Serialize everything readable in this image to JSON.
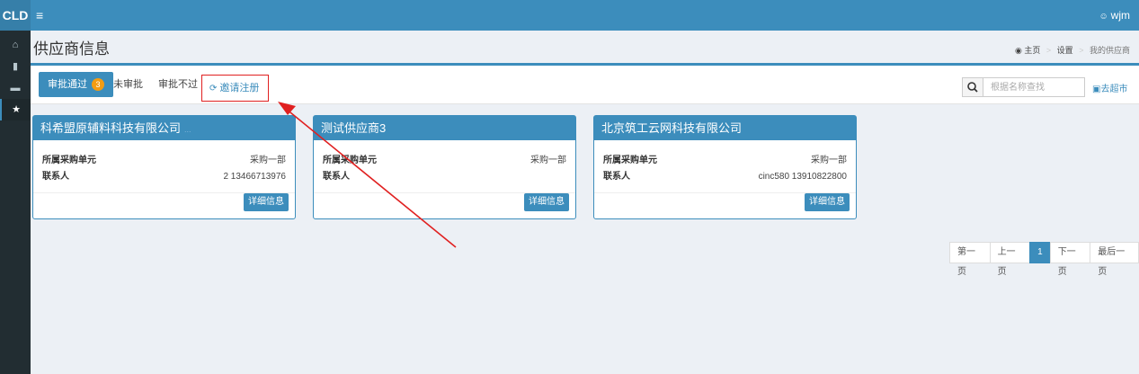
{
  "app": {
    "brand": "CLD",
    "menu_icon": "≡",
    "user": "wjm"
  },
  "sidebar": {
    "items": [
      {
        "icon": "home-icon",
        "glyph": "⌂"
      },
      {
        "icon": "bookmark-icon",
        "glyph": "▮"
      },
      {
        "icon": "briefcase-icon",
        "glyph": "▬"
      },
      {
        "icon": "star-icon",
        "glyph": "★"
      }
    ]
  },
  "page": {
    "title": "供应商信息"
  },
  "breadcrumb": {
    "home": "主页",
    "settings": "设置",
    "current": "我的供应商"
  },
  "tabs": {
    "approved": {
      "label": "审批通过",
      "count": "3"
    },
    "pending": {
      "label": "未审批"
    },
    "rejected": {
      "label": "审批不过"
    },
    "invite": {
      "label": "邀请注册"
    }
  },
  "search": {
    "placeholder": "根据名称查找"
  },
  "market_link": "去超市",
  "cards": [
    {
      "name": "科希盟原辅料科技有限公司",
      "extra": "...",
      "unit_label": "所属采购单元",
      "unit_value": "采购一部",
      "contact_label": "联系人",
      "contact_value": "2 13466713976",
      "button": "详细信息"
    },
    {
      "name": "测试供应商3",
      "extra": "",
      "unit_label": "所属采购单元",
      "unit_value": "采购一部",
      "contact_label": "联系人",
      "contact_value": "",
      "button": "详细信息"
    },
    {
      "name": "北京筑工云网科技有限公司",
      "extra": "",
      "unit_label": "所属采购单元",
      "unit_value": "采购一部",
      "contact_label": "联系人",
      "contact_value": "cinc580 13910822800",
      "button": "详细信息"
    }
  ],
  "pagination": {
    "first": "第一页",
    "prev": "上一页",
    "current": "1",
    "next": "下一页",
    "last": "最后一页"
  },
  "colors": {
    "primary": "#3c8dbc",
    "sidebar": "#222d32",
    "badge": "#f39c12",
    "annotation": "#e02020"
  }
}
